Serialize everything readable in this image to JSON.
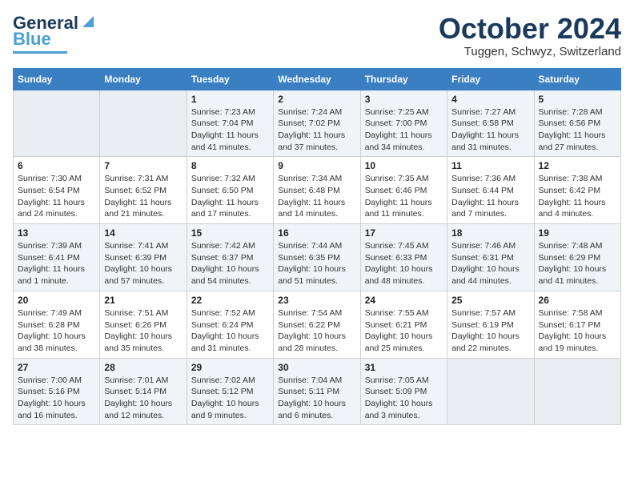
{
  "header": {
    "logo": {
      "general": "General",
      "blue": "Blue"
    },
    "title": "October 2024",
    "location": "Tuggen, Schwyz, Switzerland"
  },
  "weekdays": [
    "Sunday",
    "Monday",
    "Tuesday",
    "Wednesday",
    "Thursday",
    "Friday",
    "Saturday"
  ],
  "weeks": [
    [
      {
        "day": "",
        "info": ""
      },
      {
        "day": "",
        "info": ""
      },
      {
        "day": "1",
        "info": "Sunrise: 7:23 AM\nSunset: 7:04 PM\nDaylight: 11 hours and 41 minutes."
      },
      {
        "day": "2",
        "info": "Sunrise: 7:24 AM\nSunset: 7:02 PM\nDaylight: 11 hours and 37 minutes."
      },
      {
        "day": "3",
        "info": "Sunrise: 7:25 AM\nSunset: 7:00 PM\nDaylight: 11 hours and 34 minutes."
      },
      {
        "day": "4",
        "info": "Sunrise: 7:27 AM\nSunset: 6:58 PM\nDaylight: 11 hours and 31 minutes."
      },
      {
        "day": "5",
        "info": "Sunrise: 7:28 AM\nSunset: 6:56 PM\nDaylight: 11 hours and 27 minutes."
      }
    ],
    [
      {
        "day": "6",
        "info": "Sunrise: 7:30 AM\nSunset: 6:54 PM\nDaylight: 11 hours and 24 minutes."
      },
      {
        "day": "7",
        "info": "Sunrise: 7:31 AM\nSunset: 6:52 PM\nDaylight: 11 hours and 21 minutes."
      },
      {
        "day": "8",
        "info": "Sunrise: 7:32 AM\nSunset: 6:50 PM\nDaylight: 11 hours and 17 minutes."
      },
      {
        "day": "9",
        "info": "Sunrise: 7:34 AM\nSunset: 6:48 PM\nDaylight: 11 hours and 14 minutes."
      },
      {
        "day": "10",
        "info": "Sunrise: 7:35 AM\nSunset: 6:46 PM\nDaylight: 11 hours and 11 minutes."
      },
      {
        "day": "11",
        "info": "Sunrise: 7:36 AM\nSunset: 6:44 PM\nDaylight: 11 hours and 7 minutes."
      },
      {
        "day": "12",
        "info": "Sunrise: 7:38 AM\nSunset: 6:42 PM\nDaylight: 11 hours and 4 minutes."
      }
    ],
    [
      {
        "day": "13",
        "info": "Sunrise: 7:39 AM\nSunset: 6:41 PM\nDaylight: 11 hours and 1 minute."
      },
      {
        "day": "14",
        "info": "Sunrise: 7:41 AM\nSunset: 6:39 PM\nDaylight: 10 hours and 57 minutes."
      },
      {
        "day": "15",
        "info": "Sunrise: 7:42 AM\nSunset: 6:37 PM\nDaylight: 10 hours and 54 minutes."
      },
      {
        "day": "16",
        "info": "Sunrise: 7:44 AM\nSunset: 6:35 PM\nDaylight: 10 hours and 51 minutes."
      },
      {
        "day": "17",
        "info": "Sunrise: 7:45 AM\nSunset: 6:33 PM\nDaylight: 10 hours and 48 minutes."
      },
      {
        "day": "18",
        "info": "Sunrise: 7:46 AM\nSunset: 6:31 PM\nDaylight: 10 hours and 44 minutes."
      },
      {
        "day": "19",
        "info": "Sunrise: 7:48 AM\nSunset: 6:29 PM\nDaylight: 10 hours and 41 minutes."
      }
    ],
    [
      {
        "day": "20",
        "info": "Sunrise: 7:49 AM\nSunset: 6:28 PM\nDaylight: 10 hours and 38 minutes."
      },
      {
        "day": "21",
        "info": "Sunrise: 7:51 AM\nSunset: 6:26 PM\nDaylight: 10 hours and 35 minutes."
      },
      {
        "day": "22",
        "info": "Sunrise: 7:52 AM\nSunset: 6:24 PM\nDaylight: 10 hours and 31 minutes."
      },
      {
        "day": "23",
        "info": "Sunrise: 7:54 AM\nSunset: 6:22 PM\nDaylight: 10 hours and 28 minutes."
      },
      {
        "day": "24",
        "info": "Sunrise: 7:55 AM\nSunset: 6:21 PM\nDaylight: 10 hours and 25 minutes."
      },
      {
        "day": "25",
        "info": "Sunrise: 7:57 AM\nSunset: 6:19 PM\nDaylight: 10 hours and 22 minutes."
      },
      {
        "day": "26",
        "info": "Sunrise: 7:58 AM\nSunset: 6:17 PM\nDaylight: 10 hours and 19 minutes."
      }
    ],
    [
      {
        "day": "27",
        "info": "Sunrise: 7:00 AM\nSunset: 5:16 PM\nDaylight: 10 hours and 16 minutes."
      },
      {
        "day": "28",
        "info": "Sunrise: 7:01 AM\nSunset: 5:14 PM\nDaylight: 10 hours and 12 minutes."
      },
      {
        "day": "29",
        "info": "Sunrise: 7:02 AM\nSunset: 5:12 PM\nDaylight: 10 hours and 9 minutes."
      },
      {
        "day": "30",
        "info": "Sunrise: 7:04 AM\nSunset: 5:11 PM\nDaylight: 10 hours and 6 minutes."
      },
      {
        "day": "31",
        "info": "Sunrise: 7:05 AM\nSunset: 5:09 PM\nDaylight: 10 hours and 3 minutes."
      },
      {
        "day": "",
        "info": ""
      },
      {
        "day": "",
        "info": ""
      }
    ]
  ]
}
